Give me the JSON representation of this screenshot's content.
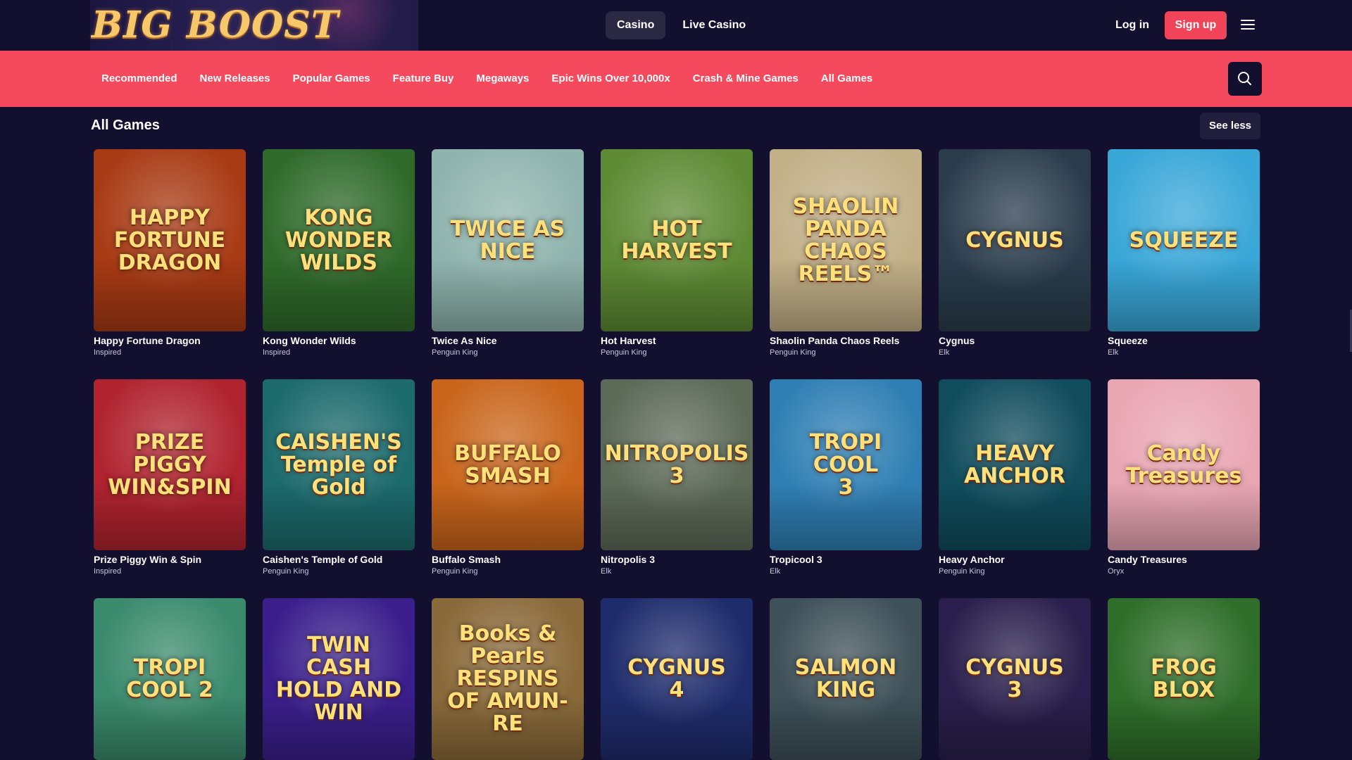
{
  "header": {
    "logo": "BIG BOOST",
    "tabs": [
      {
        "label": "Casino",
        "active": true
      },
      {
        "label": "Live Casino",
        "active": false
      }
    ],
    "login_label": "Log in",
    "signup_label": "Sign up"
  },
  "categories": [
    "Recommended",
    "New Releases",
    "Popular Games",
    "Feature Buy",
    "Megaways",
    "Epic Wins Over 10,000x",
    "Crash & Mine Games",
    "All Games"
  ],
  "section": {
    "title": "All Games",
    "toggle_label": "See less"
  },
  "games": [
    {
      "name": "Happy Fortune Dragon",
      "provider": "Inspired",
      "art": "HAPPY\nFORTUNE\nDRAGON",
      "bg": "#a83a14"
    },
    {
      "name": "Kong Wonder Wilds",
      "provider": "Inspired",
      "art": "KONG\nWONDER\nWILDS",
      "bg": "#2f6a2a"
    },
    {
      "name": "Twice As Nice",
      "provider": "Penguin King",
      "art": "TWICE AS NICE",
      "bg": "#8fb4ad"
    },
    {
      "name": "Hot Harvest",
      "provider": "Penguin King",
      "art": "HOT HARVEST",
      "bg": "#5e8a34"
    },
    {
      "name": "Shaolin Panda Chaos Reels",
      "provider": "Penguin King",
      "art": "SHAOLIN PANDA\nCHAOS REELS™",
      "bg": "#c2b088"
    },
    {
      "name": "Cygnus",
      "provider": "Elk",
      "art": "CYGNUS",
      "bg": "#2a3c4c"
    },
    {
      "name": "Squeeze",
      "provider": "Elk",
      "art": "SQUEEZE",
      "bg": "#39a7d8"
    },
    {
      "name": "Prize Piggy Win & Spin",
      "provider": "Inspired",
      "art": "PRIZE\nPIGGY\nWIN&SPIN",
      "bg": "#b0232f"
    },
    {
      "name": "Caishen's Temple of Gold",
      "provider": "Penguin King",
      "art": "CAISHEN'S\nTemple of Gold",
      "bg": "#1c6a6c"
    },
    {
      "name": "Buffalo Smash",
      "provider": "Penguin King",
      "art": "BUFFALO SMASH",
      "bg": "#c9651b"
    },
    {
      "name": "Nitropolis 3",
      "provider": "Elk",
      "art": "NITROPOLIS 3",
      "bg": "#5d6a58"
    },
    {
      "name": "Tropicool 3",
      "provider": "Elk",
      "art": "TROPI\nCOOL\n3",
      "bg": "#2f7fb4"
    },
    {
      "name": "Heavy Anchor",
      "provider": "Penguin King",
      "art": "HEAVY ANCHOR",
      "bg": "#104c5c"
    },
    {
      "name": "Candy Treasures",
      "provider": "Oryx",
      "art": "Candy\nTreasures",
      "bg": "#e9a6b3"
    },
    {
      "name": "",
      "provider": "",
      "art": "TROPI\nCOOL 2",
      "bg": "#3a8a6c"
    },
    {
      "name": "",
      "provider": "",
      "art": "TWIN\nCASH\nHOLD AND WIN",
      "bg": "#3a1f8c"
    },
    {
      "name": "",
      "provider": "",
      "art": "Books & Pearls\nRESPINS OF AMUN-RE",
      "bg": "#8a6a3a"
    },
    {
      "name": "",
      "provider": "",
      "art": "CYGNUS\n4",
      "bg": "#1f2c6c"
    },
    {
      "name": "",
      "provider": "",
      "art": "SALMON KING",
      "bg": "#3e5058"
    },
    {
      "name": "",
      "provider": "",
      "art": "CYGNUS\n3",
      "bg": "#2a1f4c"
    },
    {
      "name": "",
      "provider": "",
      "art": "FROG\nBLOX",
      "bg": "#2f6e2a"
    }
  ],
  "colors": {
    "accent": "#f54a5e",
    "background": "#120f2f",
    "signup": "#f24459"
  },
  "icons": {
    "search": "search-icon",
    "menu": "hamburger-menu-icon"
  }
}
